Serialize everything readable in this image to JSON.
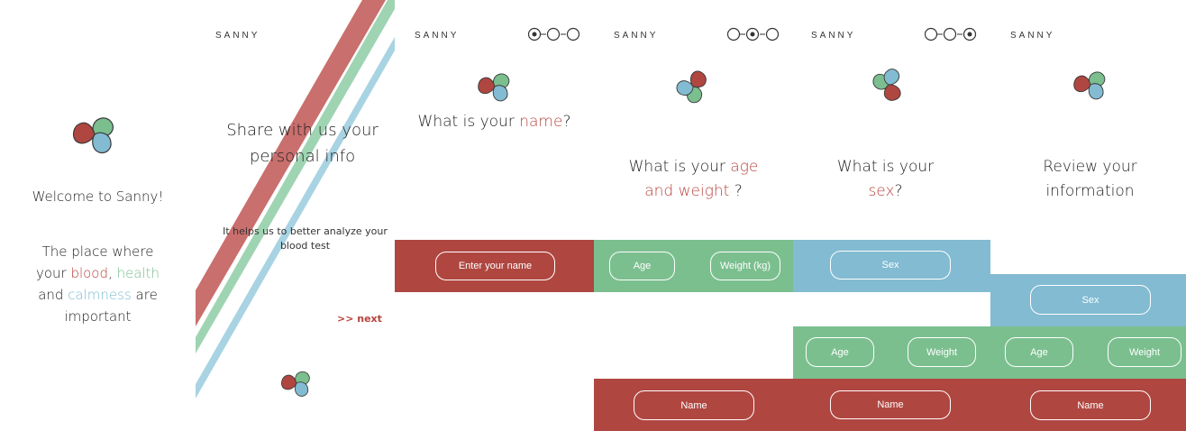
{
  "brand": "SANNY",
  "colors": {
    "red": "#b04640",
    "green": "#7bbf8f",
    "blue": "#82bbd2"
  },
  "icons": {
    "logo": "sanny-swirl-logo-icon",
    "step_circle": "step-circle-icon"
  },
  "screen1": {
    "welcome": "Welcome to Sanny!",
    "tag_line1": "The place where",
    "tag_line2_pre": "your ",
    "tag_blood": "blood",
    "tag_comma": ", ",
    "tag_health": "health",
    "tag_line3_pre": "and ",
    "tag_calmness": "calmness",
    "tag_line3_post": " are",
    "tag_line4": "important"
  },
  "screen2": {
    "brand": "SANNY",
    "title_line1": "Share with us your",
    "title_line2": "personal info",
    "subtitle_line1": "It helps us to better analyze your",
    "subtitle_line2": "blood test",
    "next": ">> next"
  },
  "screen3": {
    "brand": "SANNY",
    "q_pre": "What is your ",
    "q_highlight": "name",
    "q_post": "?",
    "input_placeholder": "Enter your name"
  },
  "screen4": {
    "brand": "SANNY",
    "q_line1_pre": "What is your ",
    "q_line1_highlight": "age",
    "q_line2_highlight": "and weight",
    "q_line2_post": " ?",
    "age": "Age",
    "weight": "Weight (kg)",
    "name": "Name"
  },
  "screen5": {
    "brand": "SANNY",
    "q_line1": "What is your",
    "q_line2_highlight": "sex",
    "q_line2_post": "?",
    "sex": "Sex",
    "age": "Age",
    "weight": "Weight",
    "name": "Name"
  },
  "screen6": {
    "brand": "SANNY",
    "title_line1": "Review your",
    "title_line2": "information",
    "sex": "Sex",
    "age": "Age",
    "weight": "Weight",
    "name": "Name"
  }
}
